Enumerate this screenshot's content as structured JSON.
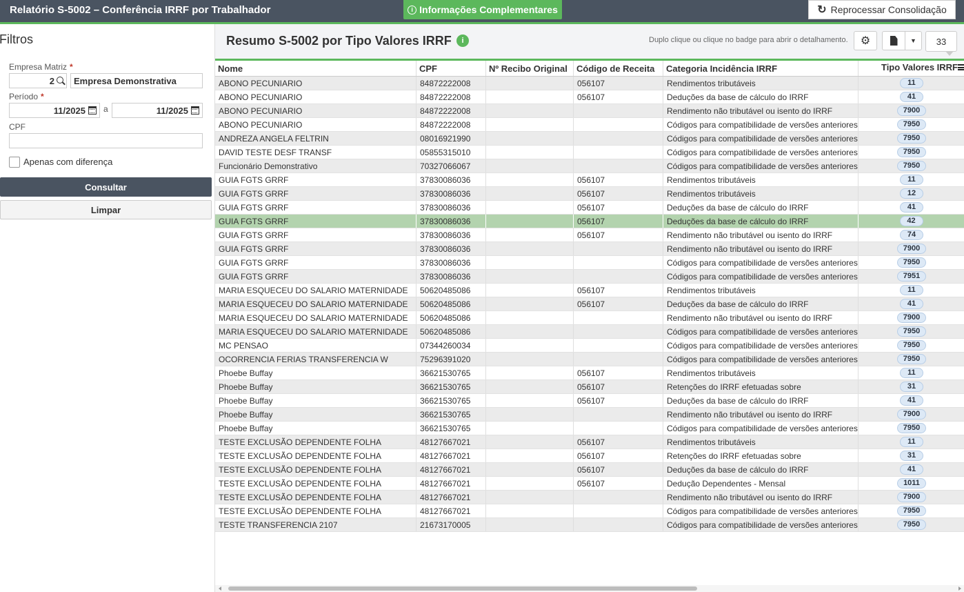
{
  "app": {
    "title": "Relatório S-5002 – Conferência IRRF por Trabalhador",
    "info_button": "Informações Complementares",
    "reprocess_button": "Reprocessar Consolidação"
  },
  "filters": {
    "title": "Filtros",
    "empresa_label": "Empresa Matriz",
    "empresa_code": "2",
    "empresa_name": "Empresa Demonstrativa",
    "periodo_label": "Período",
    "periodo_from": "11/2025",
    "periodo_sep": "a",
    "periodo_to": "11/2025",
    "cpf_label": "CPF",
    "cpf_value": "",
    "apenas_label": "Apenas com diferença",
    "consultar_button": "Consultar",
    "limpar_button": "Limpar",
    "required_mark": "*"
  },
  "main": {
    "title": "Resumo S-5002 por Tipo Valores IRRF",
    "info_dot": "i",
    "hint": "Duplo clique ou clique no badge para abrir o detalhamento.",
    "count": "33"
  },
  "grid": {
    "columns": [
      "Nome",
      "CPF",
      "Nº Recibo Original",
      "Código de Receita",
      "Categoria Incidência IRRF",
      "Tipo Valores IRRF"
    ],
    "selected_row": 10,
    "rows": [
      {
        "nome": "ABONO PECUNIARIO",
        "cpf": "84872222008",
        "recibo": "",
        "codigo": "056107",
        "categoria": "Rendimentos tributáveis",
        "tipo": "11"
      },
      {
        "nome": "ABONO PECUNIARIO",
        "cpf": "84872222008",
        "recibo": "",
        "codigo": "056107",
        "categoria": "Deduções da base de cálculo do IRRF",
        "tipo": "41"
      },
      {
        "nome": "ABONO PECUNIARIO",
        "cpf": "84872222008",
        "recibo": "",
        "codigo": "",
        "categoria": "Rendimento não tributável ou isento do IRRF",
        "tipo": "7900"
      },
      {
        "nome": "ABONO PECUNIARIO",
        "cpf": "84872222008",
        "recibo": "",
        "codigo": "",
        "categoria": "Códigos para compatibilidade de versões anteriores",
        "tipo": "7950"
      },
      {
        "nome": "ANDREZA ANGELA FELTRIN",
        "cpf": "08016921990",
        "recibo": "",
        "codigo": "",
        "categoria": "Códigos para compatibilidade de versões anteriores",
        "tipo": "7950"
      },
      {
        "nome": "DAVID TESTE DESF TRANSF",
        "cpf": "05855315010",
        "recibo": "",
        "codigo": "",
        "categoria": "Códigos para compatibilidade de versões anteriores",
        "tipo": "7950"
      },
      {
        "nome": "Funcionário Demonstrativo",
        "cpf": "70327066067",
        "recibo": "",
        "codigo": "",
        "categoria": "Códigos para compatibilidade de versões anteriores",
        "tipo": "7950"
      },
      {
        "nome": "GUIA FGTS GRRF",
        "cpf": "37830086036",
        "recibo": "",
        "codigo": "056107",
        "categoria": "Rendimentos tributáveis",
        "tipo": "11"
      },
      {
        "nome": "GUIA FGTS GRRF",
        "cpf": "37830086036",
        "recibo": "",
        "codigo": "056107",
        "categoria": "Rendimentos tributáveis",
        "tipo": "12"
      },
      {
        "nome": "GUIA FGTS GRRF",
        "cpf": "37830086036",
        "recibo": "",
        "codigo": "056107",
        "categoria": "Deduções da base de cálculo do IRRF",
        "tipo": "41"
      },
      {
        "nome": "GUIA FGTS GRRF",
        "cpf": "37830086036",
        "recibo": "",
        "codigo": "056107",
        "categoria": "Deduções da base de cálculo do IRRF",
        "tipo": "42"
      },
      {
        "nome": "GUIA FGTS GRRF",
        "cpf": "37830086036",
        "recibo": "",
        "codigo": "056107",
        "categoria": "Rendimento não tributável ou isento do IRRF",
        "tipo": "74"
      },
      {
        "nome": "GUIA FGTS GRRF",
        "cpf": "37830086036",
        "recibo": "",
        "codigo": "",
        "categoria": "Rendimento não tributável ou isento do IRRF",
        "tipo": "7900"
      },
      {
        "nome": "GUIA FGTS GRRF",
        "cpf": "37830086036",
        "recibo": "",
        "codigo": "",
        "categoria": "Códigos para compatibilidade de versões anteriores",
        "tipo": "7950"
      },
      {
        "nome": "GUIA FGTS GRRF",
        "cpf": "37830086036",
        "recibo": "",
        "codigo": "",
        "categoria": "Códigos para compatibilidade de versões anteriores",
        "tipo": "7951"
      },
      {
        "nome": "MARIA ESQUECEU DO SALARIO MATERNIDADE",
        "cpf": "50620485086",
        "recibo": "",
        "codigo": "056107",
        "categoria": "Rendimentos tributáveis",
        "tipo": "11"
      },
      {
        "nome": "MARIA ESQUECEU DO SALARIO MATERNIDADE",
        "cpf": "50620485086",
        "recibo": "",
        "codigo": "056107",
        "categoria": "Deduções da base de cálculo do IRRF",
        "tipo": "41"
      },
      {
        "nome": "MARIA ESQUECEU DO SALARIO MATERNIDADE",
        "cpf": "50620485086",
        "recibo": "",
        "codigo": "",
        "categoria": "Rendimento não tributável ou isento do IRRF",
        "tipo": "7900"
      },
      {
        "nome": "MARIA ESQUECEU DO SALARIO MATERNIDADE",
        "cpf": "50620485086",
        "recibo": "",
        "codigo": "",
        "categoria": "Códigos para compatibilidade de versões anteriores",
        "tipo": "7950"
      },
      {
        "nome": "MC PENSAO",
        "cpf": "07344260034",
        "recibo": "",
        "codigo": "",
        "categoria": "Códigos para compatibilidade de versões anteriores",
        "tipo": "7950"
      },
      {
        "nome": "OCORRENCIA FERIAS TRANSFERENCIA W",
        "cpf": "75296391020",
        "recibo": "",
        "codigo": "",
        "categoria": "Códigos para compatibilidade de versões anteriores",
        "tipo": "7950"
      },
      {
        "nome": "Phoebe Buffay",
        "cpf": "36621530765",
        "recibo": "",
        "codigo": "056107",
        "categoria": "Rendimentos tributáveis",
        "tipo": "11"
      },
      {
        "nome": "Phoebe Buffay",
        "cpf": "36621530765",
        "recibo": "",
        "codigo": "056107",
        "categoria": "Retenções do IRRF efetuadas sobre",
        "tipo": "31"
      },
      {
        "nome": "Phoebe Buffay",
        "cpf": "36621530765",
        "recibo": "",
        "codigo": "056107",
        "categoria": "Deduções da base de cálculo do IRRF",
        "tipo": "41"
      },
      {
        "nome": "Phoebe Buffay",
        "cpf": "36621530765",
        "recibo": "",
        "codigo": "",
        "categoria": "Rendimento não tributável ou isento do IRRF",
        "tipo": "7900"
      },
      {
        "nome": "Phoebe Buffay",
        "cpf": "36621530765",
        "recibo": "",
        "codigo": "",
        "categoria": "Códigos para compatibilidade de versões anteriores",
        "tipo": "7950"
      },
      {
        "nome": "TESTE EXCLUSÃO DEPENDENTE FOLHA",
        "cpf": "48127667021",
        "recibo": "",
        "codigo": "056107",
        "categoria": "Rendimentos tributáveis",
        "tipo": "11"
      },
      {
        "nome": "TESTE EXCLUSÃO DEPENDENTE FOLHA",
        "cpf": "48127667021",
        "recibo": "",
        "codigo": "056107",
        "categoria": "Retenções do IRRF efetuadas sobre",
        "tipo": "31"
      },
      {
        "nome": "TESTE EXCLUSÃO DEPENDENTE FOLHA",
        "cpf": "48127667021",
        "recibo": "",
        "codigo": "056107",
        "categoria": "Deduções da base de cálculo do IRRF",
        "tipo": "41"
      },
      {
        "nome": "TESTE EXCLUSÃO DEPENDENTE FOLHA",
        "cpf": "48127667021",
        "recibo": "",
        "codigo": "056107",
        "categoria": "Dedução Dependentes - Mensal",
        "tipo": "1011"
      },
      {
        "nome": "TESTE EXCLUSÃO DEPENDENTE FOLHA",
        "cpf": "48127667021",
        "recibo": "",
        "codigo": "",
        "categoria": "Rendimento não tributável ou isento do IRRF",
        "tipo": "7900"
      },
      {
        "nome": "TESTE EXCLUSÃO DEPENDENTE FOLHA",
        "cpf": "48127667021",
        "recibo": "",
        "codigo": "",
        "categoria": "Códigos para compatibilidade de versões anteriores",
        "tipo": "7950"
      },
      {
        "nome": "TESTE TRANSFERENCIA 2107",
        "cpf": "21673170005",
        "recibo": "",
        "codigo": "",
        "categoria": "Códigos para compatibilidade de versões anteriores",
        "tipo": "7950"
      }
    ]
  },
  "colors": {
    "topbar": "#4a5461",
    "accent_green": "#5cb85c",
    "row_alt": "#ebebeb",
    "row_selected": "#b3d3ae",
    "badge_bg": "#dde9f6"
  },
  "icons": [
    "info-icon",
    "refresh-icon",
    "search-icon",
    "calendar-icon",
    "gear-icon",
    "export-icon",
    "caret-down-icon",
    "column-menu-icon"
  ]
}
